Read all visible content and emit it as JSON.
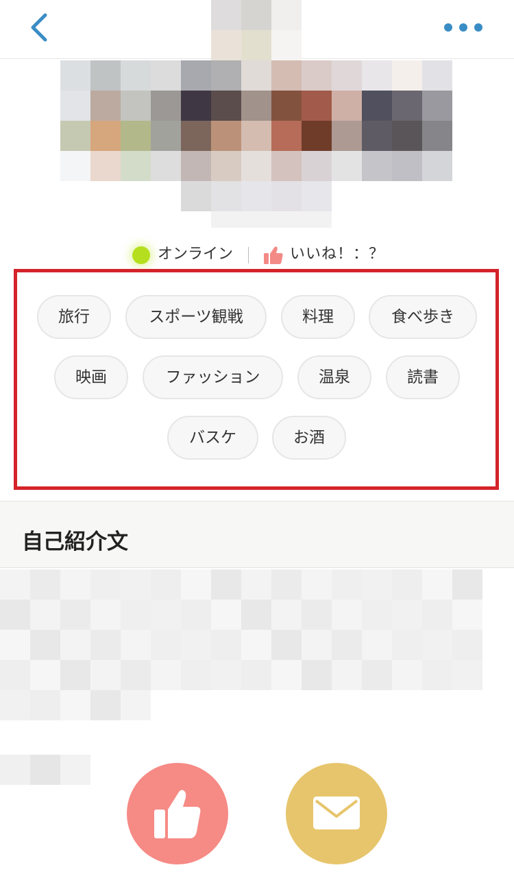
{
  "header": {
    "back_icon": "chevron-left-icon",
    "more_icon": "more-dots-icon",
    "accent_color": "#3a8dc4"
  },
  "status": {
    "online_label": "オンライン",
    "online_color": "#b5df1e",
    "like_label": "いいね！：？",
    "like_icon": "thumbs-up-icon"
  },
  "tags": [
    "旅行",
    "スポーツ観戦",
    "料理",
    "食べ歩き",
    "映画",
    "ファッション",
    "温泉",
    "読書",
    "バスケ",
    "お酒"
  ],
  "intro": {
    "title": "自己紹介文"
  },
  "actions": {
    "like_icon": "thumbs-up-icon",
    "like_color": "#f68a85",
    "message_icon": "envelope-icon",
    "message_color": "#e7c56c"
  },
  "colors": {
    "highlight_border": "#d4232a"
  }
}
